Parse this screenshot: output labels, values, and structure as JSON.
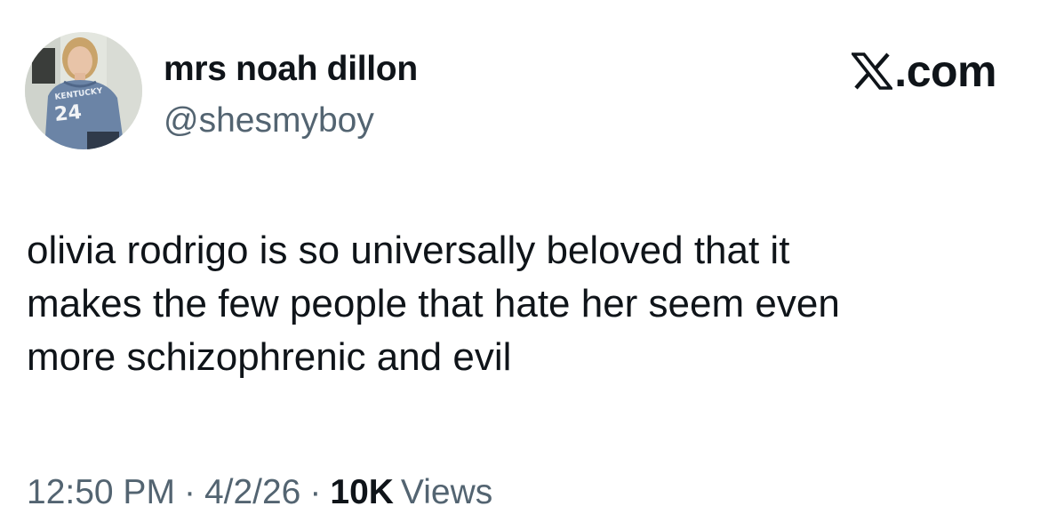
{
  "user": {
    "display_name": "mrs noah dillon",
    "handle": "@shesmyboy"
  },
  "brand": {
    "label": ".com",
    "icon": "x-logo-icon"
  },
  "tweet": {
    "lines": [
      "olivia rodrigo is so universally beloved that it",
      "makes the few people that hate her seem even",
      "more schizophrenic and evil"
    ]
  },
  "meta": {
    "time": "12:50 PM",
    "separator": "·",
    "date": "4/2/26",
    "views_count": "10K",
    "views_label": "Views"
  },
  "avatar": {
    "jersey_text": "KENTUCKY",
    "jersey_number": "24"
  },
  "colors": {
    "text_primary": "#0f1419",
    "text_secondary": "#536471",
    "background": "#ffffff"
  }
}
